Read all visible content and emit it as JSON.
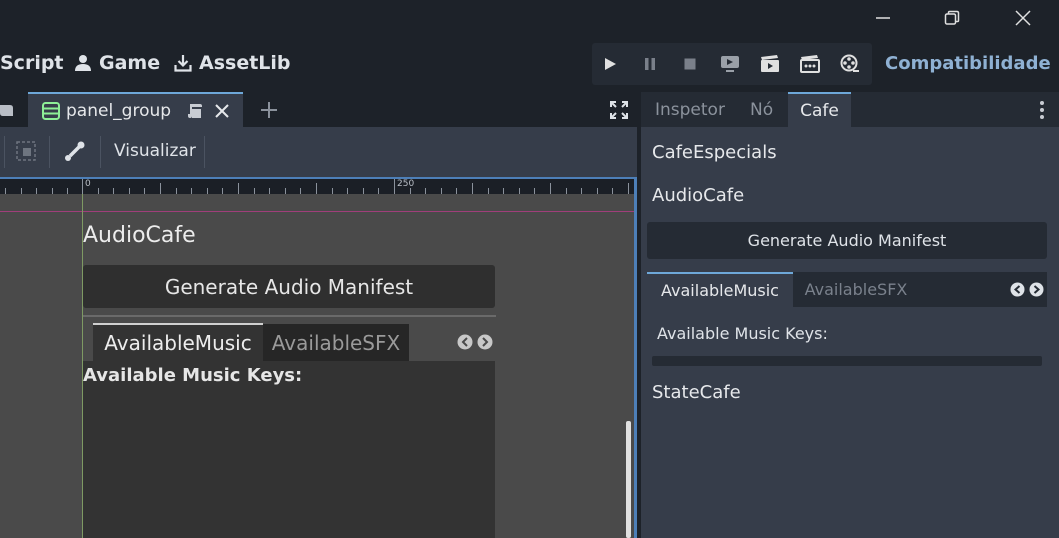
{
  "window": {
    "minimize_icon": "minimize-icon",
    "maximize_icon": "restore-icon",
    "close_icon": "close-icon"
  },
  "toolbar": {
    "script_label": "Script",
    "game_label": "Game",
    "assetlib_label": "AssetLib",
    "renderer_label": "Compatibilidade",
    "play_icons": [
      "play-icon",
      "pause-icon",
      "stop-icon",
      "remote-debug-icon",
      "run-current-scene-icon",
      "run-custom-scene-icon",
      "movie-maker-icon"
    ]
  },
  "editor": {
    "tab_label": "panel_group",
    "visualize_label": "Visualizar",
    "ruler_labels": [
      "0",
      "250"
    ]
  },
  "canvas": {
    "section_title": "AudioCafe",
    "generate_button": "Generate Audio Manifest",
    "tab_music": "AvailableMusic",
    "tab_sfx": "AvailableSFX",
    "keys_label": "Available Music Keys:"
  },
  "dock": {
    "tab_inspector": "Inspetor",
    "tab_node": "Nó",
    "tab_cafe": "Cafe",
    "cafe_especiais": "CafeEspecials",
    "audio_cafe": "AudioCafe",
    "generate_button": "Generate Audio Manifest",
    "tab_music": "AvailableMusic",
    "tab_sfx": "AvailableSFX",
    "keys_label": "Available Music Keys:",
    "state_cafe": "StateCafe"
  },
  "colors": {
    "accent": "#6ea8d9",
    "bg_dark": "#1d2229",
    "bg_panel": "#363d4a",
    "canvas_bg": "#4a4a4a",
    "renderer_text": "#8fb1d3"
  }
}
